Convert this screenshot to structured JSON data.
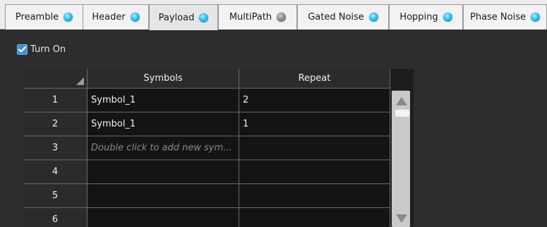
{
  "tabs": [
    {
      "label": "Preamble",
      "status": "on"
    },
    {
      "label": "Header",
      "status": "on"
    },
    {
      "label": "Payload",
      "status": "on",
      "active": true
    },
    {
      "label": "MultiPath",
      "status": "off"
    },
    {
      "label": "Gated Noise",
      "status": "on"
    },
    {
      "label": "Hopping",
      "status": "on"
    },
    {
      "label": "Phase Noise",
      "status": "on"
    }
  ],
  "turn_on": {
    "label": "Turn On",
    "checked": true
  },
  "grid": {
    "columns": [
      "Symbols",
      "Repeat"
    ],
    "rows": [
      {
        "index": "1",
        "symbol": "Symbol_1",
        "repeat": "2"
      },
      {
        "index": "2",
        "symbol": "Symbol_1",
        "repeat": "1"
      },
      {
        "index": "3",
        "symbol": "",
        "repeat": "",
        "placeholder": "Double click to add new sym..."
      },
      {
        "index": "4",
        "symbol": "",
        "repeat": ""
      },
      {
        "index": "5",
        "symbol": "",
        "repeat": ""
      },
      {
        "index": "6",
        "symbol": "",
        "repeat": ""
      }
    ]
  },
  "colors": {
    "led_on": "#34c3f4",
    "led_off": "#8e8e8e",
    "checkbox": "#3b8fd8",
    "background": "#2d2d2d"
  }
}
